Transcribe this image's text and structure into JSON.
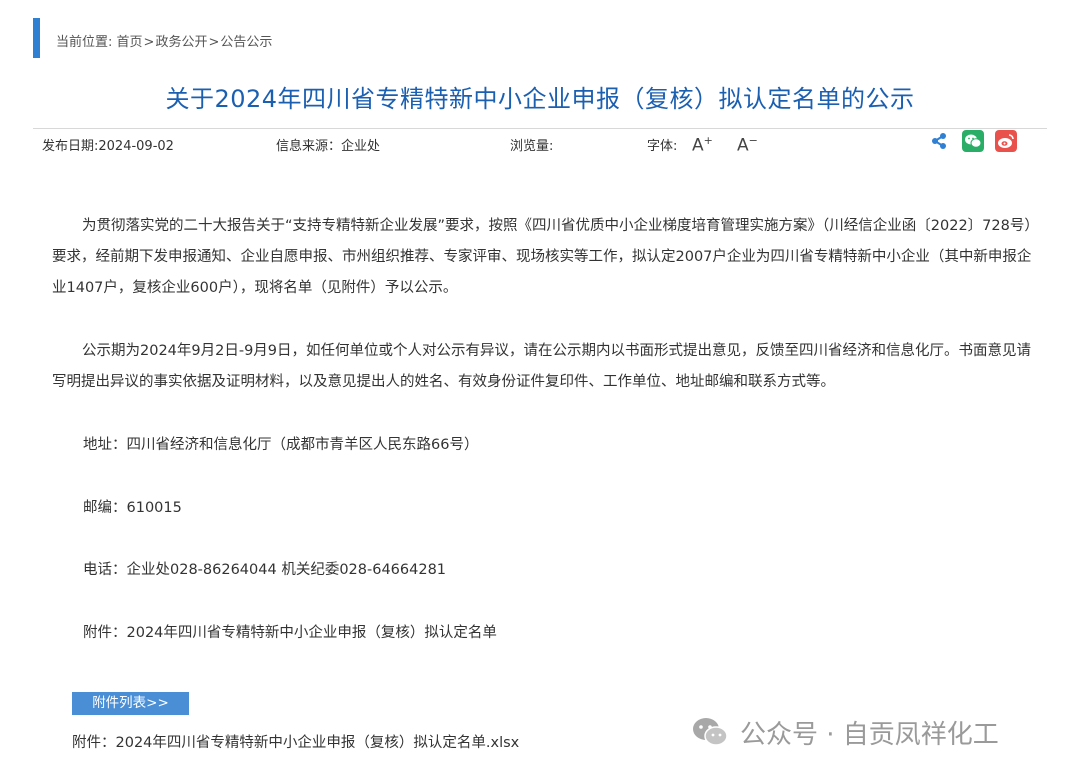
{
  "breadcrumb": {
    "prefix": "当前位置:",
    "items": [
      "首页",
      "政务公开",
      "公告公示"
    ],
    "separator": ">"
  },
  "article": {
    "title": "关于2024年四川省专精特新中小企业申报（复核）拟认定名单的公示",
    "meta": {
      "publish_date": "发布日期:2024-09-02",
      "source": "信息来源：企业处",
      "views": "浏览量:",
      "font_label": "字体:",
      "font_increase": "A",
      "font_increase_sign": "+",
      "font_decrease": "A",
      "font_decrease_sign": "−"
    },
    "paragraph1": "为贯彻落实党的二十大报告关于“支持专精特新企业发展”要求，按照《四川省优质中小企业梯度培育管理实施方案》（川经信企业函〔2022〕728号）要求，经前期下发申报通知、企业自愿申报、市州组织推荐、专家评审、现场核实等工作，拟认定2007户企业为四川省专精特新中小企业（其中新申报企业1407户，复核企业600户），现将名单（见附件）予以公示。",
    "paragraph2": "公示期为2024年9月2日-9月9日，如任何单位或个人对公示有异议，请在公示期内以书面形式提出意见，反馈至四川省经济和信息化厅。书面意见请写明提出异议的事实依据及证明材料，以及意见提出人的姓名、有效身份证件复印件、工作单位、地址邮编和联系方式等。",
    "address": "地址：四川省经济和信息化厅（成都市青羊区人民东路66号）",
    "postcode": "邮编：610015",
    "phone": "电话：企业处028-86264044   机关纪委028-64664281",
    "attachment_note": "附件：2024年四川省专精特新中小企业申报（复核）拟认定名单"
  },
  "attachments": {
    "tab_label": "附件列表>>",
    "prefix": "附件：",
    "file_name": "2024年四川省专精特新中小企业申报（复核）拟认定名单.xlsx"
  },
  "share_icons": [
    "share-icon",
    "wechat-icon",
    "weibo-icon"
  ],
  "watermark": "公众号 · 自贡凤祥化工",
  "colors": {
    "accent": "#2f7fd3",
    "title": "#1b5fb1",
    "wechat": "#2aae67",
    "weibo": "#e9524c",
    "tab": "#4a8fd6"
  }
}
